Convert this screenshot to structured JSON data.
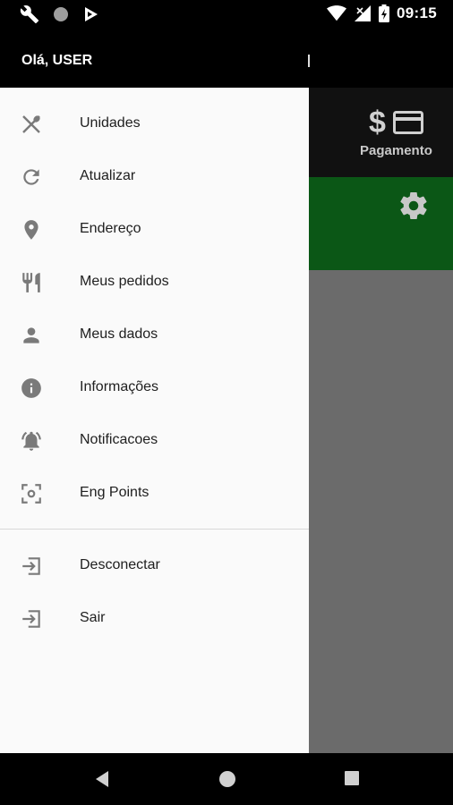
{
  "status_bar": {
    "time": "09:15",
    "left_icons": [
      "wrench-icon",
      "circle-icon",
      "play-store-icon"
    ],
    "right_icons": [
      "wifi-icon",
      "no-signal-icon",
      "battery-charging-icon"
    ]
  },
  "header": {
    "greeting": "Olá,  USER"
  },
  "background_screen": {
    "payment_label": "Pagamento",
    "icons": [
      "dollar-icon",
      "credit-card-icon",
      "gear-icon"
    ],
    "colors": {
      "top": "#111111",
      "green": "#0b5716",
      "grey": "#6b6b6b"
    }
  },
  "drawer": {
    "items": [
      {
        "icon": "utensils-crossed-icon",
        "label": "Unidades"
      },
      {
        "icon": "refresh-icon",
        "label": "Atualizar"
      },
      {
        "icon": "location-pin-icon",
        "label": "Endereço"
      },
      {
        "icon": "fork-knife-icon",
        "label": "Meus pedidos"
      },
      {
        "icon": "person-icon",
        "label": "Meus dados"
      },
      {
        "icon": "info-icon",
        "label": "Informações"
      },
      {
        "icon": "bell-ringing-icon",
        "label": "Notificacoes"
      },
      {
        "icon": "scan-target-icon",
        "label": "Eng Points"
      }
    ],
    "secondary_items": [
      {
        "icon": "exit-icon",
        "label": "Desconectar"
      },
      {
        "icon": "exit-icon",
        "label": "Sair"
      }
    ]
  },
  "nav_bar": {
    "buttons": [
      "back-icon",
      "home-icon",
      "recents-icon"
    ]
  }
}
